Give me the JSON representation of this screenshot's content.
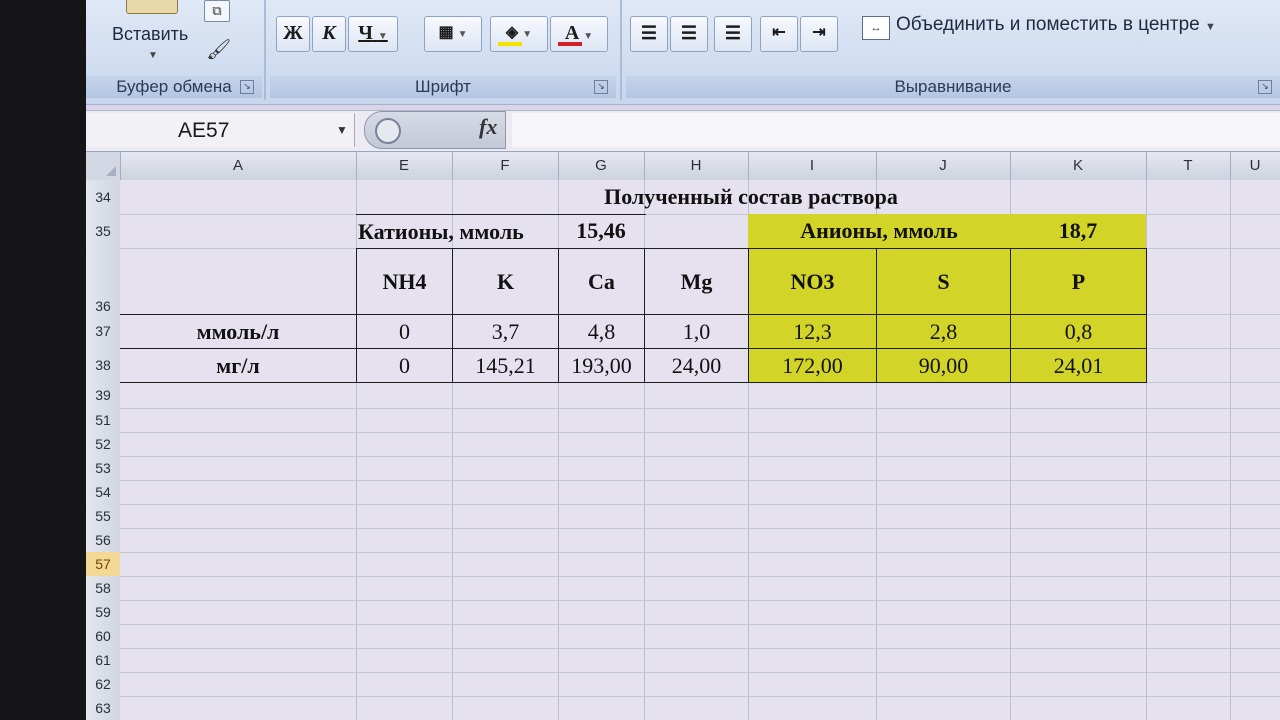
{
  "ribbon": {
    "clipboard": {
      "paste_label": "Вставить",
      "group_label": "Буфер обмена"
    },
    "font": {
      "bold": "Ж",
      "italic": "К",
      "underline": "Ч",
      "group_label": "Шрифт",
      "fill_color": "#f2e300",
      "font_color": "#d0202a"
    },
    "alignment": {
      "merge_label": "Объединить и поместить в центре",
      "group_label": "Выравнивание"
    }
  },
  "formula_bar": {
    "name_box": "AE57",
    "fx": "fx",
    "formula": ""
  },
  "columns": [
    "A",
    "E",
    "F",
    "G",
    "H",
    "I",
    "J",
    "K",
    "T",
    "U"
  ],
  "rows": [
    "34",
    "35",
    "36",
    "37",
    "38",
    "39",
    "51",
    "52",
    "53",
    "54",
    "55",
    "56",
    "57",
    "58",
    "59",
    "60",
    "61",
    "62",
    "63"
  ],
  "active_row": "57",
  "sheet": {
    "title": "Полученный состав раствора",
    "cations_label": "Катионы, ммоль",
    "cations_total": "15,46",
    "anions_label": "Анионы, ммоль",
    "anions_total": "18,7",
    "headers": [
      "NH4",
      "K",
      "Ca",
      "Mg",
      "NO3",
      "S",
      "P"
    ],
    "rows": [
      {
        "label": "ммоль/л",
        "values": [
          "0",
          "3,7",
          "4,8",
          "1,0",
          "12,3",
          "2,8",
          "0,8"
        ]
      },
      {
        "label": "мг/л",
        "values": [
          "0",
          "145,21",
          "193,00",
          "24,00",
          "172,00",
          "90,00",
          "24,01"
        ]
      }
    ],
    "highlight_color": "#d2d428"
  }
}
